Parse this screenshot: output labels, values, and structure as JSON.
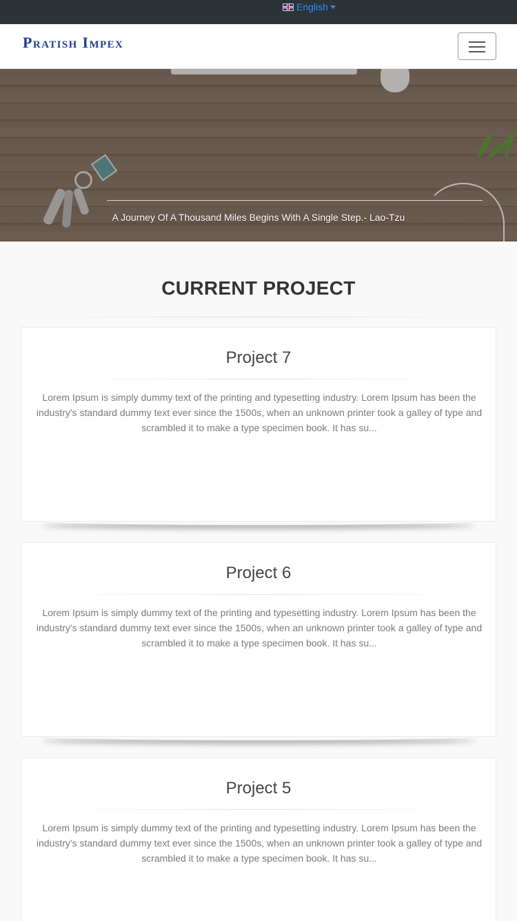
{
  "topbar": {
    "language_label": "English",
    "flag_icon": "uk-flag-icon"
  },
  "navbar": {
    "brand": "Pratish Impex",
    "menu_icon": "hamburger-menu-icon"
  },
  "hero": {
    "quote": "A Journey Of A Thousand Miles Begins With A Single Step.- Lao-Tzu"
  },
  "section": {
    "title_light": "CURRENT ",
    "title_bold": "PROJECT"
  },
  "projects": [
    {
      "title": "Project 7",
      "excerpt": "Lorem Ipsum is simply dummy text of the printing and typesetting industry. Lorem Ipsum has been the industry's standard dummy text ever since the 1500s, when an unknown printer took a galley of type and scrambled it to make a type specimen book. It has su..."
    },
    {
      "title": "Project 6",
      "excerpt": "Lorem Ipsum is simply dummy text of the printing and typesetting industry. Lorem Ipsum has been the industry's standard dummy text ever since the 1500s, when an unknown printer took a galley of type and scrambled it to make a type specimen book. It has su..."
    },
    {
      "title": "Project 5",
      "excerpt": "Lorem Ipsum is simply dummy text of the printing and typesetting industry. Lorem Ipsum has been the industry's standard dummy text ever since the 1500s, when an unknown printer took a galley of type and scrambled it to make a type specimen book. It has su..."
    }
  ],
  "colors": {
    "topbar": "#2b3337",
    "link": "#2f8cff",
    "brand": "#1f3f8f",
    "page_bg": "#f9f9f9"
  }
}
